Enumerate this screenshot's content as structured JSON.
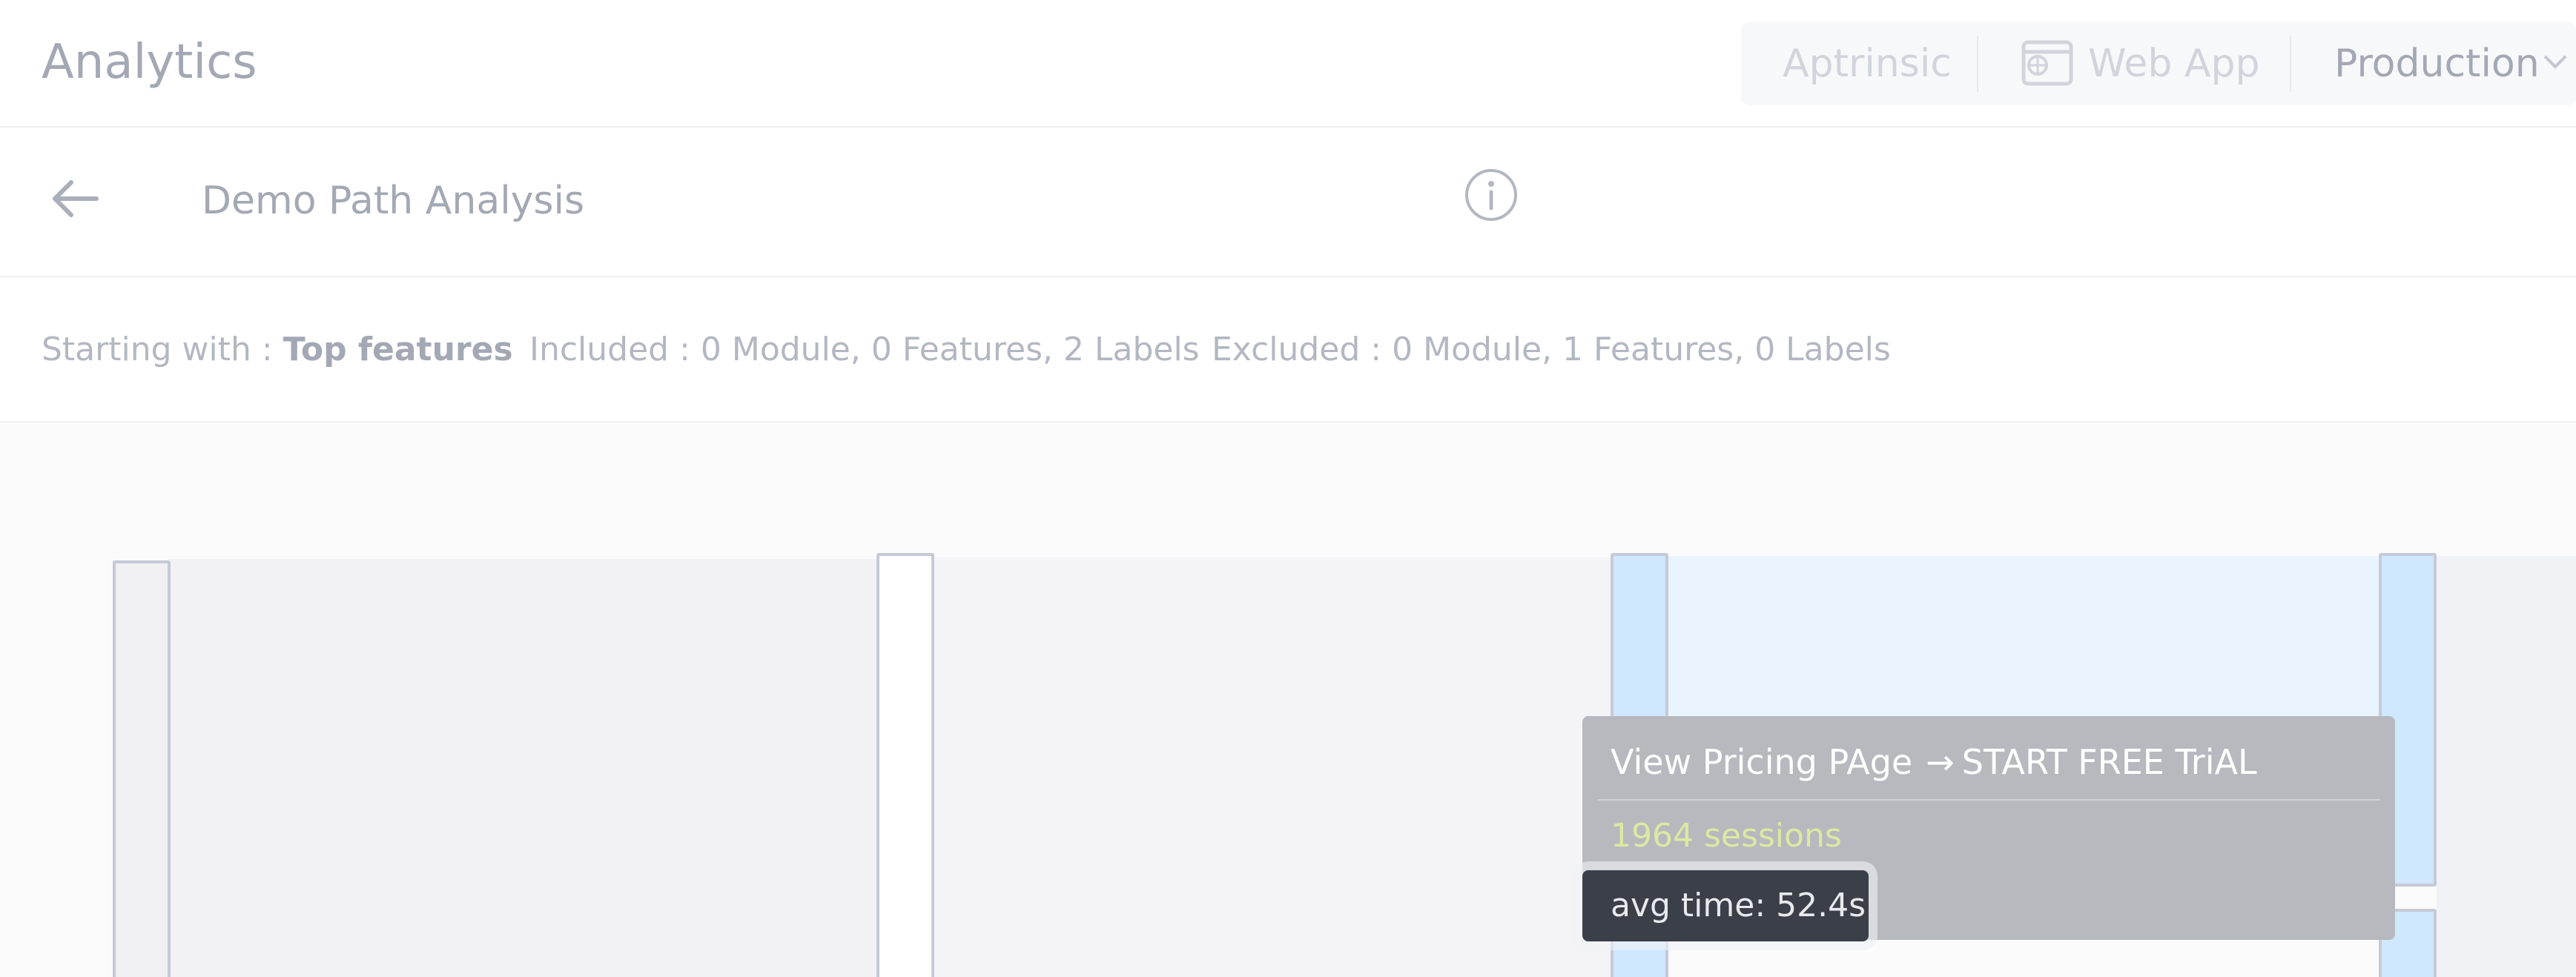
{
  "header": {
    "app_title": "Analytics",
    "context": {
      "account": "Aptrinsic",
      "product": "Web App",
      "product_icon": "browser-globe-icon",
      "environment": "Production",
      "environment_icon": "chevron-down-icon"
    }
  },
  "subheader": {
    "back_icon": "arrow-left-icon",
    "title": "Demo Path Analysis",
    "info_icon": "info-circle-icon"
  },
  "filters": {
    "starting_label": "Starting with : ",
    "starting_value": "Top features",
    "included": "Included : 0 Module, 0 Features, 2 Labels",
    "excluded": "Excluded : 0 Module, 1 Features, 0 Labels"
  },
  "tooltip": {
    "from": "View Pricing PAge",
    "arrow": "→",
    "to": "START FREE TriAL",
    "sessions": "1964 sessions",
    "avg_time": "avg time: 52.4s"
  },
  "colors": {
    "highlight_node": "#cfe8fe",
    "highlight_flow": "#eaf4fe",
    "node_border": "#c6cad7",
    "tooltip_bg": "#b7b9be",
    "sessions_text": "#dce9a2",
    "avg_bg": "#3a3f48"
  }
}
